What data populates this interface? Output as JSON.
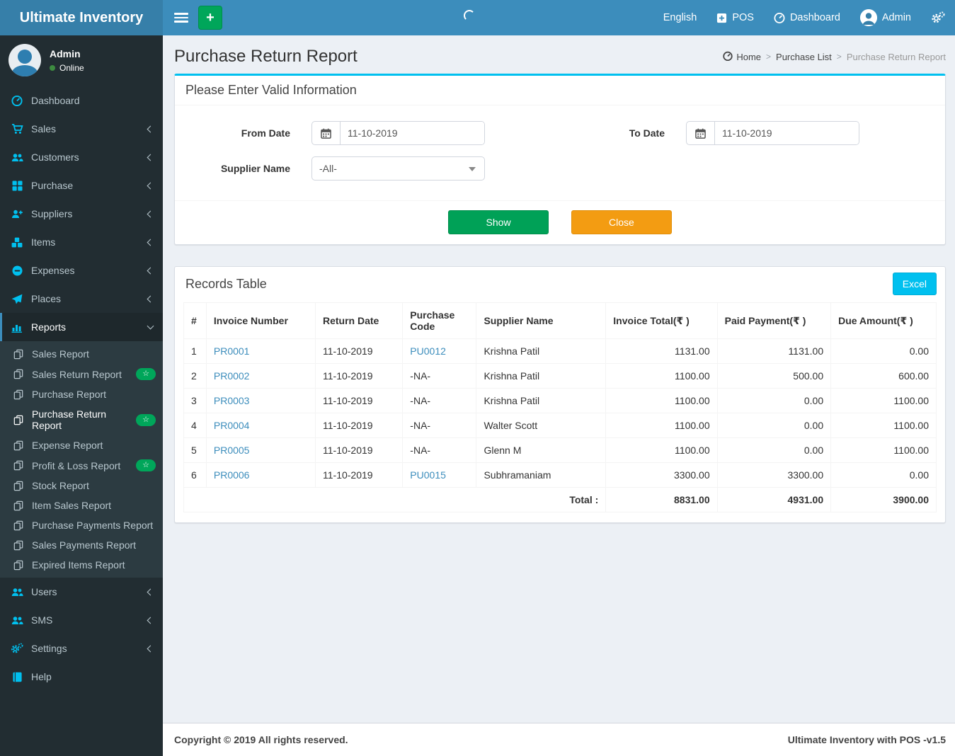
{
  "brand": {
    "title": "Ultimate Inventory"
  },
  "navbar": {
    "language": "English",
    "pos": {
      "label": "POS",
      "icon": "plus-square-icon"
    },
    "dashboard": {
      "label": "Dashboard",
      "icon": "tachometer-icon"
    },
    "user": {
      "label": "Admin",
      "icon": "avatar-icon"
    },
    "settings_icon": "cogs-icon",
    "menu_icon": "hamburger-icon",
    "add_icon": "plus-icon",
    "add_label": "+"
  },
  "sidebar": {
    "user": {
      "name": "Admin",
      "status": "Online"
    },
    "items": [
      {
        "label": "Dashboard",
        "icon": "tachometer-icon"
      },
      {
        "label": "Sales",
        "icon": "cart-icon"
      },
      {
        "label": "Customers",
        "icon": "users-icon"
      },
      {
        "label": "Purchase",
        "icon": "grid-icon"
      },
      {
        "label": "Suppliers",
        "icon": "user-plus-icon"
      },
      {
        "label": "Items",
        "icon": "cubes-icon"
      },
      {
        "label": "Expenses",
        "icon": "minus-circle-icon"
      },
      {
        "label": "Places",
        "icon": "paper-plane-icon"
      },
      {
        "label": "Reports",
        "icon": "bar-chart-icon"
      }
    ],
    "report_items": [
      {
        "label": "Sales Report",
        "icon": "copy-icon"
      },
      {
        "label": "Sales Return Report",
        "icon": "copy-icon",
        "badge": "☆"
      },
      {
        "label": "Purchase Report",
        "icon": "copy-icon"
      },
      {
        "label": "Purchase Return Report",
        "icon": "copy-icon",
        "badge": "☆"
      },
      {
        "label": "Expense Report",
        "icon": "copy-icon"
      },
      {
        "label": "Profit & Loss Report",
        "icon": "copy-icon",
        "badge": "☆"
      },
      {
        "label": "Stock Report",
        "icon": "copy-icon"
      },
      {
        "label": "Item Sales Report",
        "icon": "copy-icon"
      },
      {
        "label": "Purchase Payments Report",
        "icon": "copy-icon"
      },
      {
        "label": "Sales Payments Report",
        "icon": "copy-icon"
      },
      {
        "label": "Expired Items Report",
        "icon": "copy-icon"
      }
    ],
    "bottom_items": [
      {
        "label": "Users",
        "icon": "users-icon"
      },
      {
        "label": "SMS",
        "icon": "users-icon"
      },
      {
        "label": "Settings",
        "icon": "cogs-icon"
      },
      {
        "label": "Help",
        "icon": "book-icon"
      }
    ]
  },
  "page": {
    "title": "Purchase Return Report",
    "breadcrumb": {
      "home": "Home",
      "mid": "Purchase List",
      "current": "Purchase Return Report"
    }
  },
  "filter_panel": {
    "title": "Please Enter Valid Information",
    "from_date": {
      "label": "From Date",
      "value": "11-10-2019",
      "icon": "calendar-icon"
    },
    "to_date": {
      "label": "To Date",
      "value": "11-10-2019",
      "icon": "calendar-icon"
    },
    "supplier": {
      "label": "Supplier Name",
      "value": "-All-"
    },
    "show_label": "Show",
    "close_label": "Close"
  },
  "records": {
    "title": "Records Table",
    "excel_label": "Excel",
    "columns": [
      "#",
      "Invoice Number",
      "Return Date",
      "Purchase Code",
      "Supplier Name",
      "Invoice Total(₹ )",
      "Paid Payment(₹ )",
      "Due Amount(₹ )"
    ],
    "rows": [
      {
        "num": "1",
        "invoice": "PR0001",
        "return_date": "11-10-2019",
        "purchase_code": "PU0012",
        "supplier": "Krishna Patil",
        "invoice_total": "1131.00",
        "paid": "1131.00",
        "due": "0.00"
      },
      {
        "num": "2",
        "invoice": "PR0002",
        "return_date": "11-10-2019",
        "purchase_code": "-NA-",
        "supplier": "Krishna Patil",
        "invoice_total": "1100.00",
        "paid": "500.00",
        "due": "600.00"
      },
      {
        "num": "3",
        "invoice": "PR0003",
        "return_date": "11-10-2019",
        "purchase_code": "-NA-",
        "supplier": "Krishna Patil",
        "invoice_total": "1100.00",
        "paid": "0.00",
        "due": "1100.00"
      },
      {
        "num": "4",
        "invoice": "PR0004",
        "return_date": "11-10-2019",
        "purchase_code": "-NA-",
        "supplier": "Walter Scott",
        "invoice_total": "1100.00",
        "paid": "0.00",
        "due": "1100.00"
      },
      {
        "num": "5",
        "invoice": "PR0005",
        "return_date": "11-10-2019",
        "purchase_code": "-NA-",
        "supplier": "Glenn M",
        "invoice_total": "1100.00",
        "paid": "0.00",
        "due": "1100.00"
      },
      {
        "num": "6",
        "invoice": "PR0006",
        "return_date": "11-10-2019",
        "purchase_code": "PU0015",
        "supplier": "Subhramaniam",
        "invoice_total": "3300.00",
        "paid": "3300.00",
        "due": "0.00"
      }
    ],
    "total": {
      "label": "Total :",
      "invoice_total": "8831.00",
      "paid": "4931.00",
      "due": "3900.00"
    }
  },
  "footer": {
    "left": "Copyright © 2019 All rights reserved.",
    "right": "Ultimate Inventory with POS -v1.5"
  },
  "colors": {
    "navbar": "#3c8dbc",
    "brand": "#367fa9",
    "sidebar": "#222d32",
    "sidebar_icon": "#00c0ef",
    "accent_top_border": "#00c0ef",
    "success": "#00a157",
    "warning": "#f39c12",
    "info": "#00c0ef",
    "online_dot": "#3d8b40",
    "link": "#3c8dbc"
  }
}
